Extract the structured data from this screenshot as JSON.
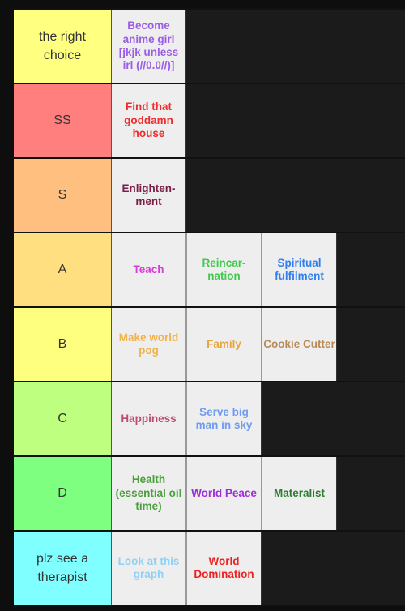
{
  "tiers": [
    {
      "label": "the right choice",
      "color": "#ffff80",
      "items": [
        {
          "text": "Become anime girl [jkjk unless irl (//0.0//)]",
          "color": "#9b5de5"
        }
      ]
    },
    {
      "label": "SS",
      "color": "#ff7f7f",
      "items": [
        {
          "text": "Find that goddamn house",
          "color": "#ef2b2b"
        }
      ]
    },
    {
      "label": "S",
      "color": "#ffbf7f",
      "items": [
        {
          "text": "Enlighten-ment",
          "color": "#7a1f4a"
        }
      ]
    },
    {
      "label": "A",
      "color": "#ffdf80",
      "items": [
        {
          "text": "Teach",
          "color": "#d63fd6"
        },
        {
          "text": "Reincar-nation",
          "color": "#3fca4a"
        },
        {
          "text": "Spiritual fulfilment",
          "color": "#2f7ff0"
        }
      ]
    },
    {
      "label": "B",
      "color": "#ffff7f",
      "items": [
        {
          "text": "Make world pog",
          "color": "#f2b34a"
        },
        {
          "text": "Family",
          "color": "#e6a63c"
        },
        {
          "text": "Cookie Cutter",
          "color": "#b98a58"
        }
      ]
    },
    {
      "label": "C",
      "color": "#bfff7f",
      "items": [
        {
          "text": "Happiness",
          "color": "#c04b6e"
        },
        {
          "text": "Serve big man in sky",
          "color": "#6e9cf2"
        }
      ]
    },
    {
      "label": "D",
      "color": "#7fff7f",
      "items": [
        {
          "text": "Health (essential oil time)",
          "color": "#4aa03c"
        },
        {
          "text": "World Peace",
          "color": "#9b2fd8"
        },
        {
          "text": "Materalist",
          "color": "#2e7d32"
        }
      ]
    },
    {
      "label": "plz see a therapist",
      "color": "#7fffff",
      "items": [
        {
          "text": "Look at this graph",
          "color": "#8fd0f5"
        },
        {
          "text": "World Domination",
          "color": "#ef2020"
        }
      ]
    }
  ]
}
